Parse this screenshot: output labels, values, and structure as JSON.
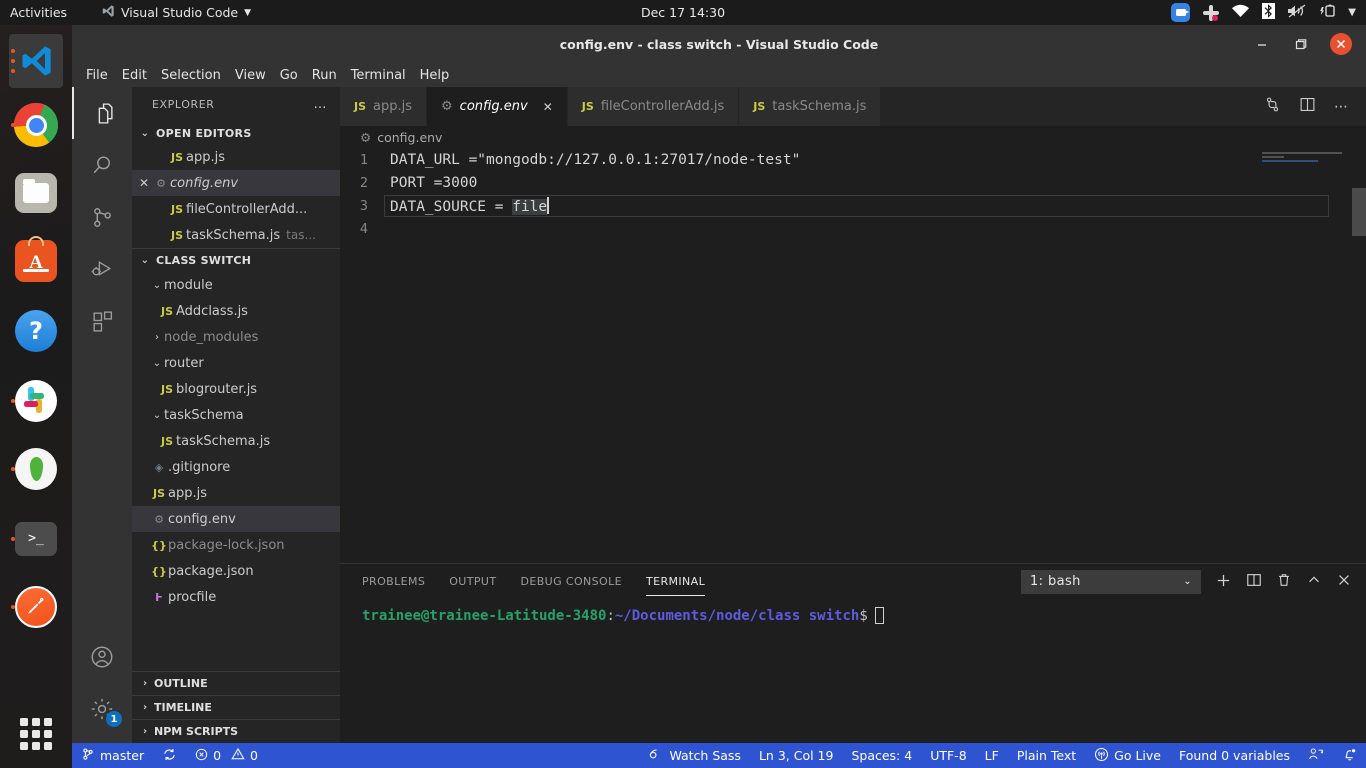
{
  "gnome": {
    "activities": "Activities",
    "app_name": "Visual Studio Code",
    "clock": "Dec 17  14:30",
    "tray": [
      "camera-icon",
      "slack-icon",
      "wifi-icon",
      "bluetooth-icon",
      "volume-muted-icon",
      "battery-icon",
      "chevron-down-icon"
    ]
  },
  "dock": {
    "items": [
      {
        "name": "visual-studio-code",
        "running": true
      },
      {
        "name": "google-chrome",
        "running": true
      },
      {
        "name": "files",
        "running": false
      },
      {
        "name": "ubuntu-software",
        "running": false
      },
      {
        "name": "help",
        "running": false
      },
      {
        "name": "slack",
        "running": true
      },
      {
        "name": "mongodb-compass",
        "running": true
      },
      {
        "name": "terminal",
        "running": true
      },
      {
        "name": "postman",
        "running": true
      }
    ],
    "show_apps": "show-applications"
  },
  "window": {
    "title": "config.env - class switch - Visual Studio Code",
    "minimize": "—",
    "maximize": "❐",
    "close": "✕"
  },
  "menubar": [
    "File",
    "Edit",
    "Selection",
    "View",
    "Go",
    "Run",
    "Terminal",
    "Help"
  ],
  "activitybar": {
    "items": [
      {
        "name": "explorer-icon",
        "active": true
      },
      {
        "name": "search-icon",
        "active": false
      },
      {
        "name": "source-control-icon",
        "active": false
      },
      {
        "name": "run-debug-icon",
        "active": false
      },
      {
        "name": "extensions-icon",
        "active": false
      }
    ],
    "accounts": "accounts-icon",
    "settings": "manage-gear-icon",
    "settings_badge": "1"
  },
  "sidebar": {
    "header": "EXPLORER",
    "more_actions": "…",
    "open_editors": {
      "title": "OPEN EDITORS",
      "items": [
        {
          "label": "app.js",
          "icon": "js",
          "selected": false,
          "dirty": false,
          "sub": ""
        },
        {
          "label": "config.env",
          "icon": "gear",
          "selected": true,
          "dirty": false,
          "sub": "",
          "italic": true
        },
        {
          "label": "fileControllerAdd...",
          "icon": "js",
          "selected": false,
          "sub": ""
        },
        {
          "label": "taskSchema.js",
          "icon": "js",
          "selected": false,
          "sub": "tas..."
        }
      ]
    },
    "project": {
      "title": "CLASS SWITCH",
      "items": [
        {
          "label": "module",
          "kind": "folder",
          "expanded": true,
          "indent": 1
        },
        {
          "label": "Addclass.js",
          "kind": "js",
          "indent": 2
        },
        {
          "label": "node_modules",
          "kind": "folder",
          "expanded": false,
          "indent": 1,
          "muted": true
        },
        {
          "label": "router",
          "kind": "folder",
          "expanded": true,
          "indent": 1
        },
        {
          "label": "blogrouter.js",
          "kind": "js",
          "indent": 2
        },
        {
          "label": "taskSchema",
          "kind": "folder",
          "expanded": true,
          "indent": 1
        },
        {
          "label": "taskSchema.js",
          "kind": "js",
          "indent": 2
        },
        {
          "label": ".gitignore",
          "kind": "git",
          "indent": 1
        },
        {
          "label": "app.js",
          "kind": "js",
          "indent": 1
        },
        {
          "label": "config.env",
          "kind": "gear",
          "indent": 1,
          "selected": true
        },
        {
          "label": "package-lock.json",
          "kind": "json",
          "indent": 1,
          "muted": true
        },
        {
          "label": "package.json",
          "kind": "json",
          "indent": 1
        },
        {
          "label": "procfile",
          "kind": "procfile",
          "indent": 1
        }
      ]
    },
    "bottom_sections": [
      "OUTLINE",
      "TIMELINE",
      "NPM SCRIPTS"
    ]
  },
  "tabs": [
    {
      "label": "app.js",
      "icon": "js",
      "active": false,
      "closable": false
    },
    {
      "label": "config.env",
      "icon": "gear",
      "active": true,
      "closable": true,
      "italic": true
    },
    {
      "label": "fileControllerAdd.js",
      "icon": "js",
      "active": false,
      "closable": false
    },
    {
      "label": "taskSchema.js",
      "icon": "js",
      "active": false,
      "closable": false
    }
  ],
  "editor_actions": [
    "split-diff-icon",
    "split-editor-icon",
    "more-actions-icon"
  ],
  "breadcrumb": {
    "icon": "gear-icon",
    "path": "config.env"
  },
  "editor": {
    "lines": [
      {
        "num": "1",
        "text": "DATA_URL =\"mongodb://127.0.0.1:27017/node-test\""
      },
      {
        "num": "2",
        "text": "PORT =3000"
      },
      {
        "num": "3",
        "prefix": "DATA_SOURCE = ",
        "selected": "file",
        "current": true
      },
      {
        "num": "4",
        "text": ""
      }
    ]
  },
  "panel": {
    "tabs": [
      "PROBLEMS",
      "OUTPUT",
      "DEBUG CONSOLE",
      "TERMINAL"
    ],
    "active_tab": "TERMINAL",
    "terminal_select": "1: bash",
    "actions": [
      "new-terminal-icon",
      "split-terminal-icon",
      "kill-terminal-icon",
      "maximize-panel-icon",
      "close-panel-icon"
    ],
    "prompt_user": "trainee@trainee-Latitude-3480",
    "prompt_colon": ":",
    "prompt_path": "~/Documents/node/class switch",
    "prompt_dollar": "$"
  },
  "statusbar": {
    "branch": "master",
    "sync_icon": "sync-icon",
    "errors": "0",
    "warnings": "0",
    "watch_sass": "Watch Sass",
    "cursor": "Ln 3, Col 19",
    "indent": "Spaces: 4",
    "encoding": "UTF-8",
    "eol": "LF",
    "language": "Plain Text",
    "go_live": "Go Live",
    "variables": "Found 0 variables",
    "remote": "remote-icon",
    "bell": "notifications-icon",
    "accent": "#2f54d1"
  }
}
